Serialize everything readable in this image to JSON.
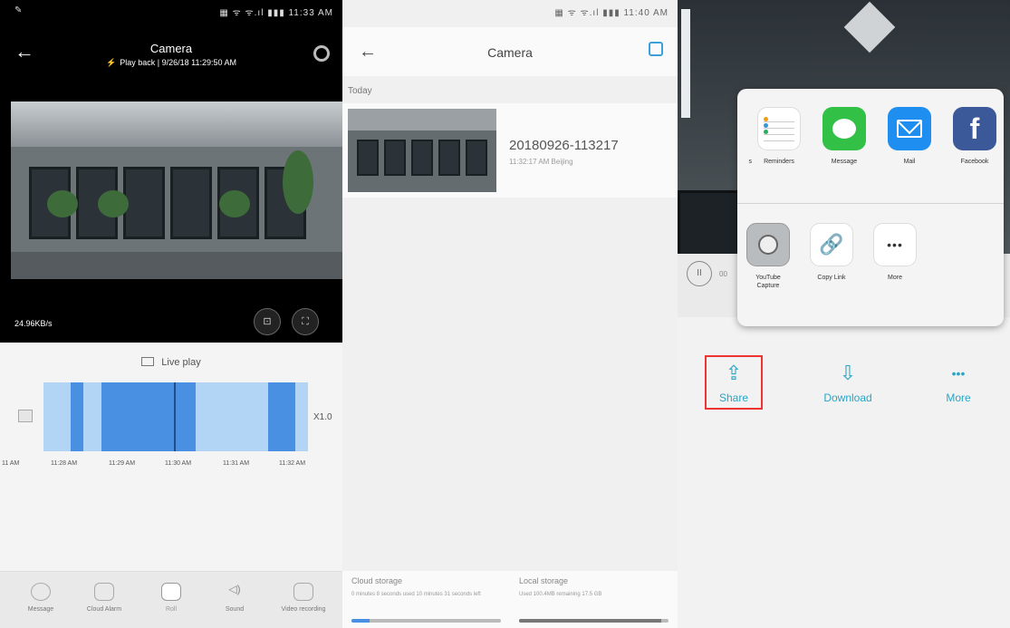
{
  "screen1": {
    "status_left": "✎",
    "status_right": "▦ ᯤ ᯤ.ıl ▮▮▮ 11:33 AM",
    "back": "←",
    "title": "Camera",
    "subtitle_icon": "⚡",
    "subtitle": "Play back | 9/26/18 11:29:50 AM",
    "speed": "24.96KB/s",
    "cam_btn_1": "⊡",
    "cam_btn_2": "⛶",
    "live_play": "Live play",
    "zoom": "X1.0",
    "ticks": [
      "11 AM",
      "11:28 AM",
      "11:29 AM",
      "11:30 AM",
      "11:31 AM",
      "11:32 AM"
    ],
    "bottom_items": [
      {
        "label": "Message"
      },
      {
        "label": "Cloud Alarm"
      },
      {
        "label": "",
        "sub": "Roll"
      },
      {
        "label": "Sound"
      },
      {
        "label": "Video recording"
      }
    ]
  },
  "screen2": {
    "status_right": "▦ ᯤ ᯤ.ıl ▮▮▮ 11:40 AM",
    "back": "←",
    "title": "Camera",
    "section": "Today",
    "record_name": "20180926-113217",
    "record_meta": "11:32:17 AM Beijing",
    "cloud_title": "Cloud storage",
    "cloud_desc": "0 minutes 8 seconds used 10 minutes 31 seconds left",
    "cloud_used": 0.12,
    "local_title": "Local storage",
    "local_desc": "Used 100.4MB remaining 17.5 GB",
    "local_used": 0.95
  },
  "screen3": {
    "pause": "II",
    "playback_text": "00",
    "sheet_apps_row1": [
      {
        "label": "Reminders"
      },
      {
        "label": "Message"
      },
      {
        "label": "Mail"
      },
      {
        "label": "Facebook"
      }
    ],
    "edge_letter": "s",
    "sheet_apps_row2": [
      {
        "label": "YouTube Capture"
      },
      {
        "label": "Copy Link"
      },
      {
        "label": "More"
      }
    ],
    "fb_glyph": "f",
    "link_glyph": "🔗",
    "more_glyph": "•••",
    "actions": [
      {
        "label": "Share",
        "icon": "⇪"
      },
      {
        "label": "Download",
        "icon": "⇩"
      },
      {
        "label": "More",
        "icon": "•••"
      }
    ]
  },
  "colors": {
    "accent_blue": "#4a90e2",
    "timeline_light": "#b3d5f5",
    "teal": "#2aa5c5",
    "highlight_red": "#ee3333"
  }
}
